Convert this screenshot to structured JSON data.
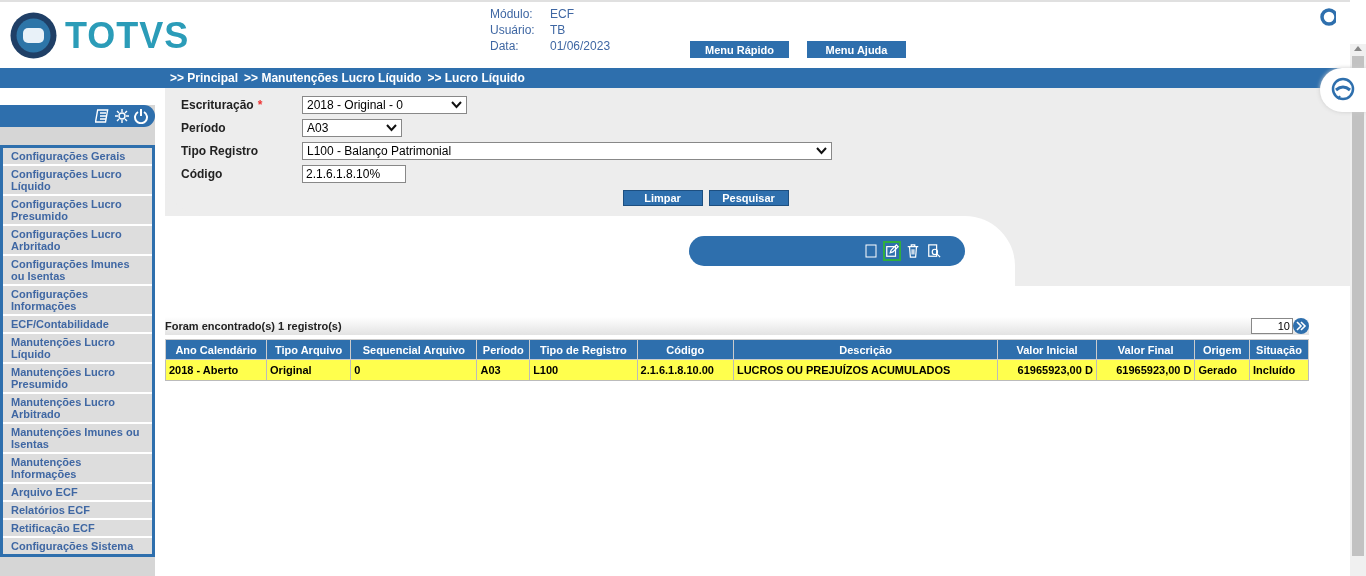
{
  "header": {
    "brand": "TOTVS",
    "info": [
      {
        "label": "Módulo:",
        "value": "ECF"
      },
      {
        "label": "Usuário:",
        "value": "TB"
      },
      {
        "label": "Data:",
        "value": "01/06/2023"
      }
    ],
    "buttons": [
      "Menu Rápido",
      "Menu Ajuda"
    ]
  },
  "breadcrumb": [
    ">> Principal",
    ">> Manutenções Lucro Líquido",
    ">> Lucro Líquido"
  ],
  "sidebar": {
    "items": [
      {
        "label": "Configurações Gerais"
      },
      {
        "label": "Configurações Lucro Líquido"
      },
      {
        "label": "Configurações Lucro Presumido"
      },
      {
        "label": "Configurações Lucro Arbritado"
      },
      {
        "label": "Configurações Imunes ou Isentas"
      },
      {
        "label": "Configurações Informações"
      },
      {
        "label": "ECF/Contabilidade"
      },
      {
        "label": "Manutenções Lucro Líquido"
      },
      {
        "label": "Manutenções Lucro Presumido"
      },
      {
        "label": "Manutenções Lucro Arbitrado"
      },
      {
        "label": "Manutenções Imunes ou Isentas"
      },
      {
        "label": "Manutenções Informações"
      },
      {
        "label": "Arquivo ECF"
      },
      {
        "label": "Relatórios ECF"
      },
      {
        "label": "Retificação ECF"
      },
      {
        "label": "Configurações Sistema"
      }
    ]
  },
  "form": {
    "fields": [
      {
        "label": "Escrituração",
        "marker": "*",
        "kind": "select",
        "value": "2018 - Original - 0"
      },
      {
        "label": "Período",
        "kind": "select",
        "value": "A03"
      },
      {
        "label": "Tipo Registro",
        "kind": "select",
        "value": "L100 - Balanço Patrimonial"
      },
      {
        "label": "Código",
        "kind": "text",
        "value": "2.1.6.1.8.10%"
      }
    ],
    "buttons": [
      "Limpar",
      "Pesquisar"
    ]
  },
  "toolbar": {
    "actions": [
      {
        "kind": "checkbox",
        "selected": false
      },
      {
        "kind": "edit",
        "selected": true
      },
      {
        "kind": "delete",
        "selected": false
      },
      {
        "kind": "view",
        "selected": false
      }
    ]
  },
  "results": {
    "summary": "Foram encontrado(s) 1 registro(s)",
    "page_size": "10",
    "table": {
      "columns": [
        "Ano Calendário",
        "Tipo Arquivo",
        "Sequencial Arquivo",
        "Período",
        "Tipo de Registro",
        "Código",
        "Descrição",
        "Valor Inicial",
        "Valor Final",
        "Origem",
        "Situação"
      ],
      "rows": [
        {
          "selected": true,
          "cells": [
            "2018 -  Aberto",
            "Original",
            "0",
            "A03",
            "L100",
            "2.1.6.1.8.10.00",
            "LUCROS OU PREJUÍZOS ACUMULADOS",
            "61965923,00 D",
            "61965923,00 D",
            "Gerado",
            "Incluído"
          ]
        }
      ]
    }
  }
}
